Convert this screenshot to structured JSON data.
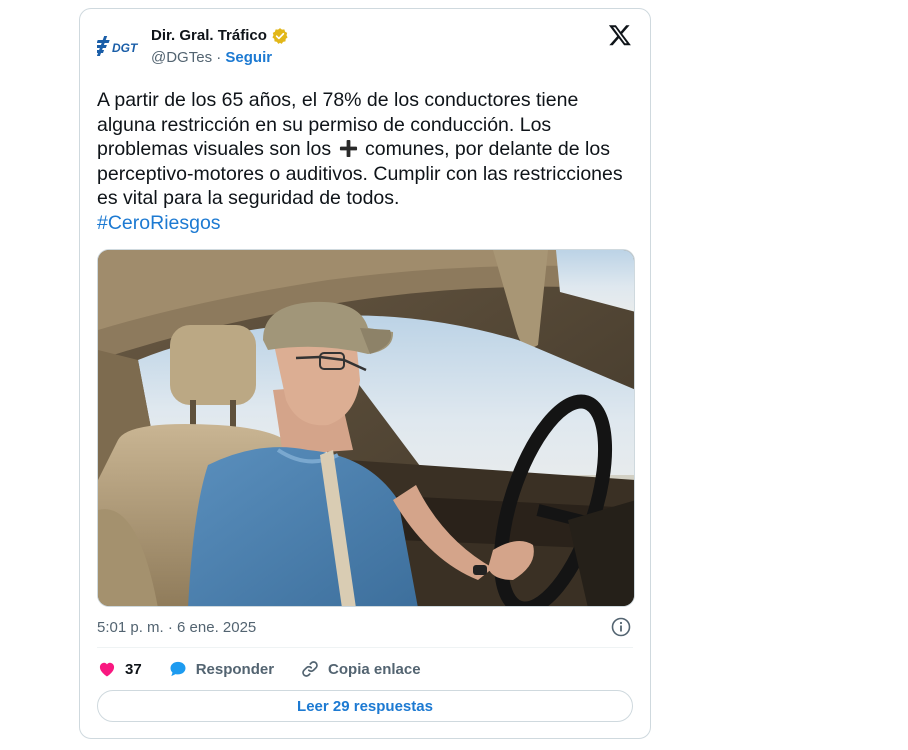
{
  "author": {
    "display_name": "Dir. Gral. Tráfico",
    "handle": "@DGTes",
    "separator": " · ",
    "follow_label": "Seguir",
    "logo_text": "DGT",
    "verified_color": "#e2b719"
  },
  "tweet": {
    "text_part1": "A partir de los 65 años, el 78% de los conductores tiene alguna restricción en su permiso de conducción. Los problemas visuales son los",
    "text_part2": "comunes, por delante de los perceptivo-motores o auditivos. Cumplir con las restricciones es vital para la seguridad de todos.",
    "hashtag": "#CeroRiesgos",
    "emoji": "plus-icon"
  },
  "meta": {
    "timestamp": "5:01 p. m. · 6 ene. 2025"
  },
  "actions": {
    "likes": "37",
    "reply_label": "Responder",
    "copy_link_label": "Copia enlace"
  },
  "read_replies_label": "Leer 29 respuestas",
  "colors": {
    "accent": "#1d7ad2",
    "like": "#f91880",
    "muted": "#536471",
    "text": "#0f1419"
  }
}
